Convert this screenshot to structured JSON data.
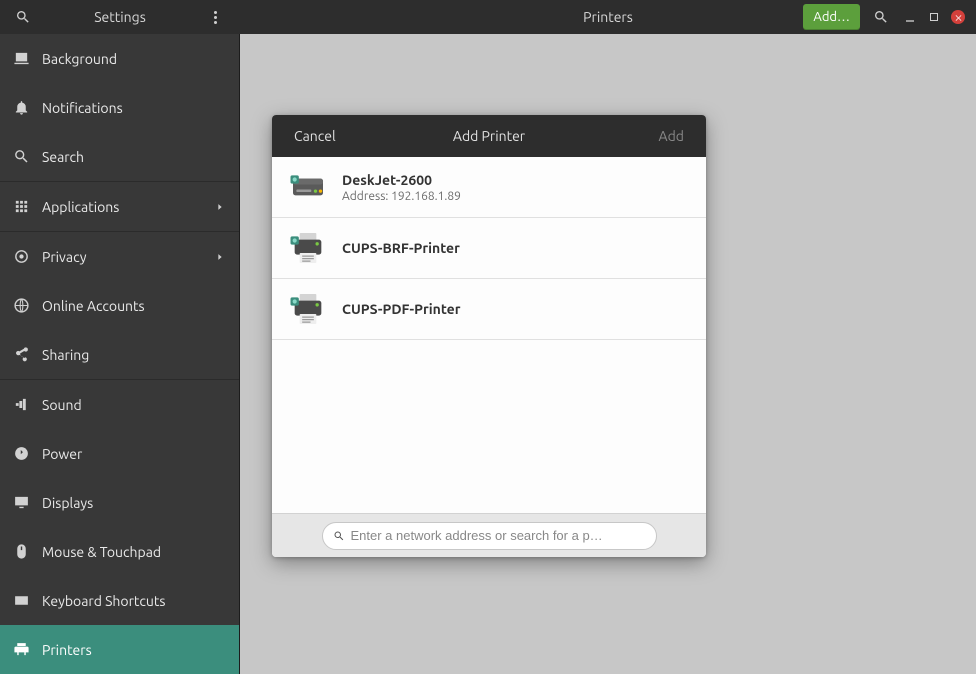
{
  "header": {
    "settings_title": "Settings",
    "pane_title": "Printers",
    "add_button": "Add…"
  },
  "sidebar": {
    "items": [
      {
        "key": "background",
        "label": "Background",
        "chevron": false
      },
      {
        "key": "notifications",
        "label": "Notifications",
        "chevron": false
      },
      {
        "key": "search",
        "label": "Search",
        "chevron": false
      },
      {
        "key": "applications",
        "label": "Applications",
        "chevron": true
      },
      {
        "key": "privacy",
        "label": "Privacy",
        "chevron": true
      },
      {
        "key": "online-accounts",
        "label": "Online Accounts",
        "chevron": false
      },
      {
        "key": "sharing",
        "label": "Sharing",
        "chevron": false
      },
      {
        "key": "sound",
        "label": "Sound",
        "chevron": false
      },
      {
        "key": "power",
        "label": "Power",
        "chevron": false
      },
      {
        "key": "displays",
        "label": "Displays",
        "chevron": false
      },
      {
        "key": "mouse",
        "label": "Mouse & Touchpad",
        "chevron": false
      },
      {
        "key": "keyboard",
        "label": "Keyboard Shortcuts",
        "chevron": false
      },
      {
        "key": "printers",
        "label": "Printers",
        "chevron": false
      }
    ],
    "selected": "printers"
  },
  "dialog": {
    "cancel": "Cancel",
    "title": "Add Printer",
    "add": "Add",
    "search_placeholder": "Enter a network address or search for a p…",
    "printers": [
      {
        "name": "DeskJet-2600",
        "icon": "network",
        "address": "Address: 192.168.1.89"
      },
      {
        "name": "CUPS-BRF-Printer",
        "icon": "local",
        "address": ""
      },
      {
        "name": "CUPS-PDF-Printer",
        "icon": "local",
        "address": ""
      }
    ]
  },
  "icons": {
    "search": "search-icon",
    "menu": "menu-icon"
  }
}
